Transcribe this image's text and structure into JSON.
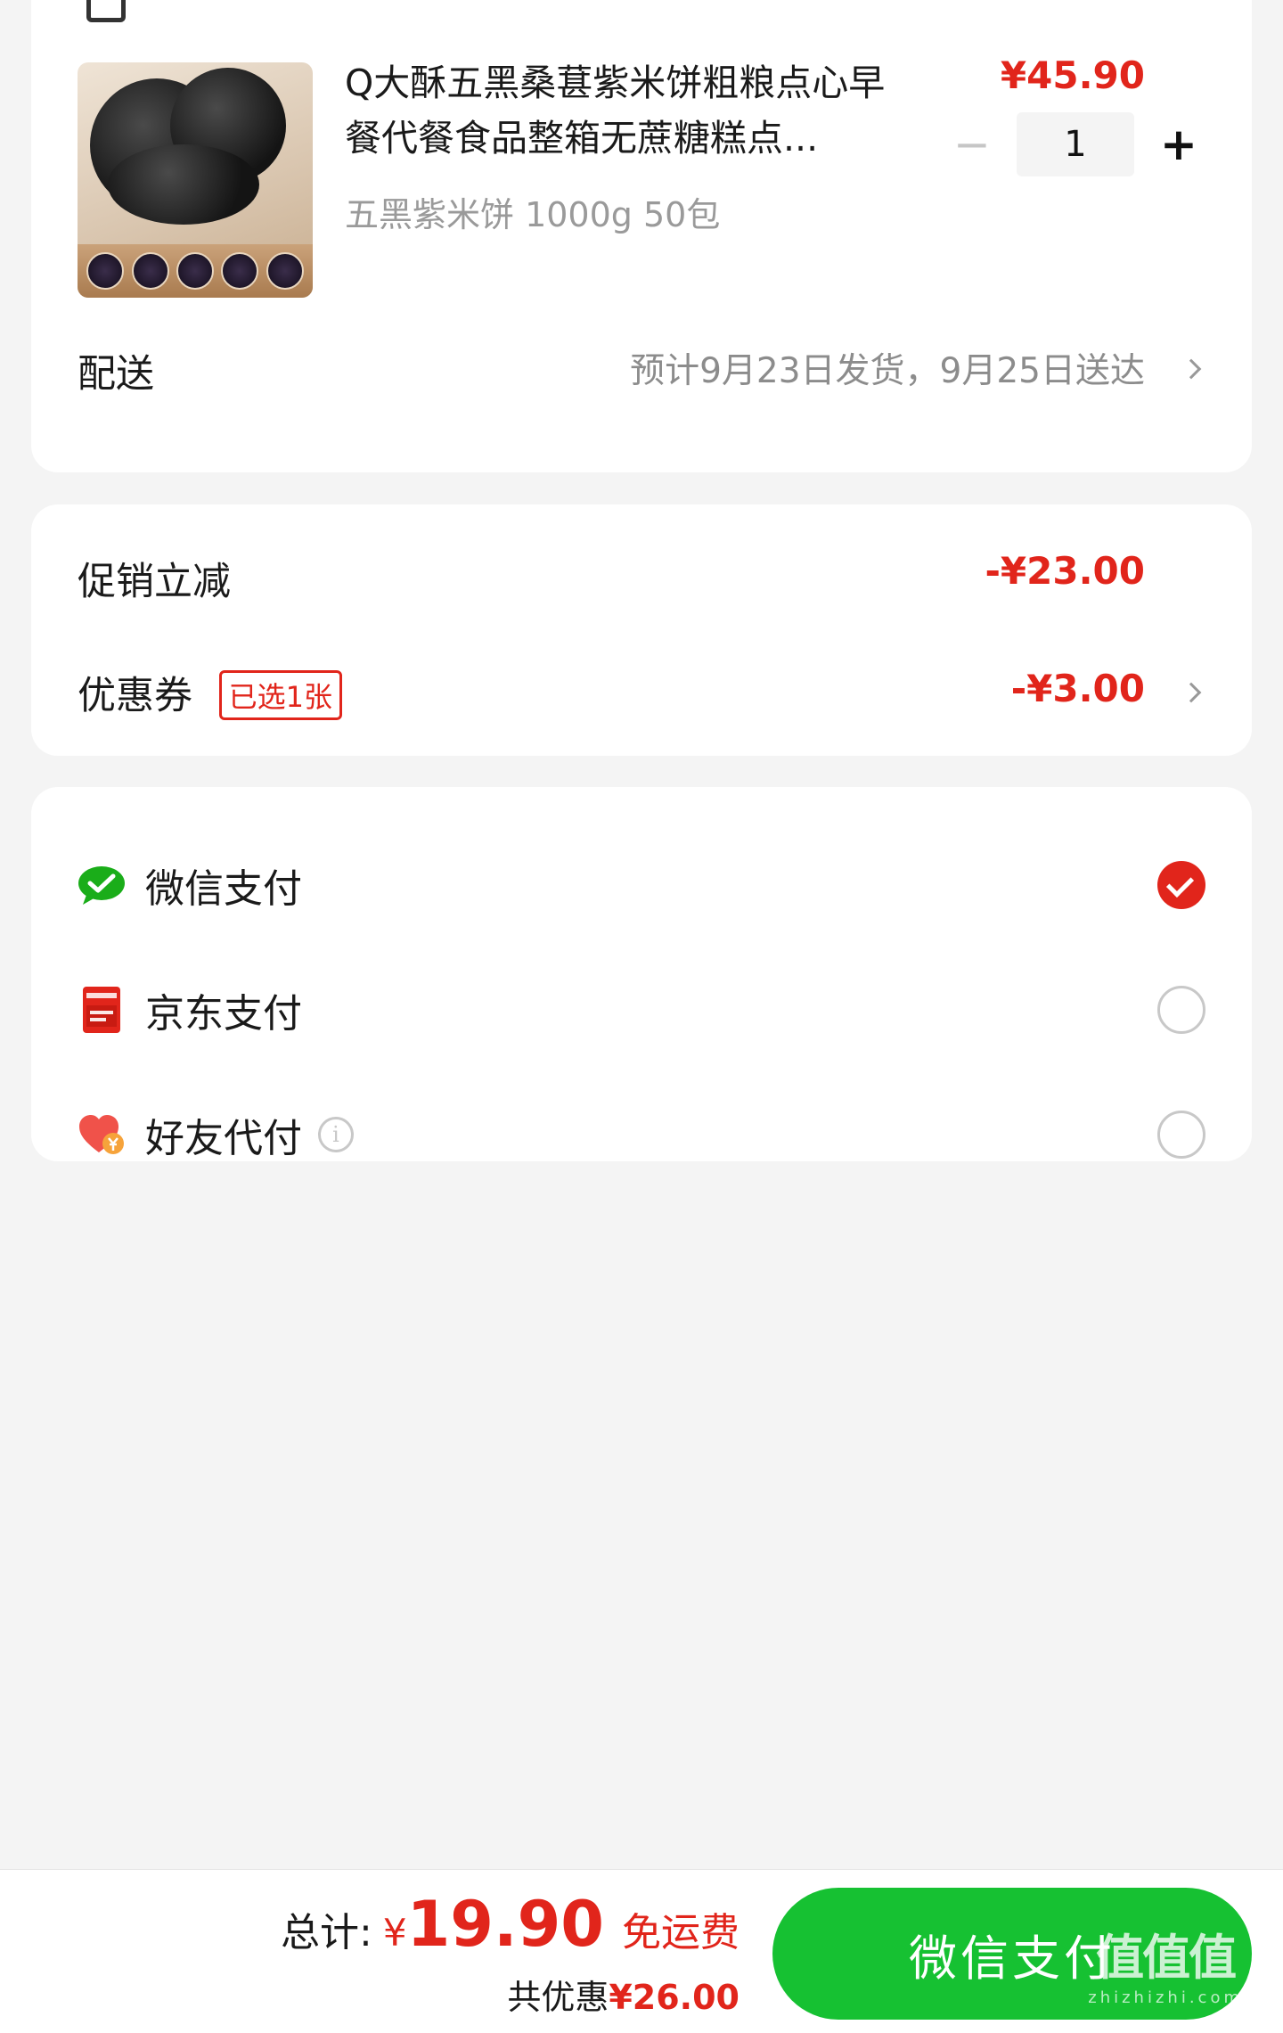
{
  "store": {
    "icon": "store-icon",
    "name": ""
  },
  "product": {
    "title": "Q大酥五黑桑葚紫米饼粗粮点心早餐代餐食品整箱无蔗糖糕点...",
    "spec": "五黑紫米饼 1000g 50包",
    "price": "¥45.90",
    "quantity": "1",
    "qty_minus": "−",
    "qty_plus": "+"
  },
  "delivery": {
    "label": "配送",
    "value": "预计9月23日发货，9月25日送达"
  },
  "discount": {
    "promo_label": "促销立减",
    "promo_amount": "-¥23.00",
    "coupon_label": "优惠券",
    "coupon_tag": "已选1张",
    "coupon_amount": "-¥3.00"
  },
  "payment": {
    "methods": [
      {
        "label": "微信支付",
        "icon": "wechat-pay-icon",
        "selected": true
      },
      {
        "label": "京东支付",
        "icon": "jd-pay-icon",
        "selected": false
      },
      {
        "label": "好友代付",
        "icon": "friend-pay-icon",
        "selected": false
      }
    ],
    "info_glyph": "i"
  },
  "footer": {
    "total_label": "总计:",
    "currency": "¥",
    "total_amount": "19.90",
    "free_shipping": "免运费",
    "saved_label": "共优惠",
    "saved_amount": "¥26.00",
    "pay_button": "微信支付",
    "watermark_main": "值值值",
    "watermark_sub": "zhizhizhi.com"
  },
  "colors": {
    "accent_red": "#e1251b",
    "pay_green": "#16c132",
    "background": "#f4f4f4"
  }
}
